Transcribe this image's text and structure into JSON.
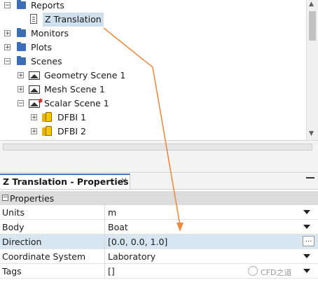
{
  "tree": {
    "items": [
      {
        "label": "Reports",
        "type": "folder",
        "expander": "−"
      },
      {
        "label": "Z Translation",
        "type": "report",
        "selected": true
      },
      {
        "label": "Monitors",
        "type": "folder",
        "expander": "+"
      },
      {
        "label": "Plots",
        "type": "folder",
        "expander": "+"
      },
      {
        "label": "Scenes",
        "type": "folder",
        "expander": "−"
      },
      {
        "label": "Geometry Scene 1",
        "type": "scene",
        "expander": "+"
      },
      {
        "label": "Mesh Scene 1",
        "type": "scene",
        "expander": "+"
      },
      {
        "label": "Scalar Scene 1",
        "type": "scene",
        "expander": "−",
        "modified": true
      },
      {
        "label": "DFBI 1",
        "type": "dfbi",
        "expander": "+"
      },
      {
        "label": "DFBI 2",
        "type": "dfbi",
        "expander": "+"
      }
    ]
  },
  "properties_panel": {
    "title": "Z Translation - Properties",
    "close": "×",
    "section": "Properties",
    "section_expander": "−",
    "rows": [
      {
        "name": "Units",
        "value": "m",
        "control": "dropdown"
      },
      {
        "name": "Body",
        "value": "Boat",
        "control": "dropdown"
      },
      {
        "name": "Direction",
        "value": "[0.0, 0.0, 1.0]",
        "control": "ellipsis",
        "highlighted": true
      },
      {
        "name": "Coordinate System",
        "value": "Laboratory",
        "control": "dropdown"
      },
      {
        "name": "Tags",
        "value": "[]",
        "control": "dropdown"
      }
    ],
    "ellipsis_label": "..."
  },
  "watermark": "CFD之道",
  "colors": {
    "folder": "#3a6eb5",
    "selection": "#cfe0ec",
    "row_highlight": "#d7e6f1",
    "annotation_arrow": "#f08a3c",
    "tab_accent": "#3b78c6"
  }
}
